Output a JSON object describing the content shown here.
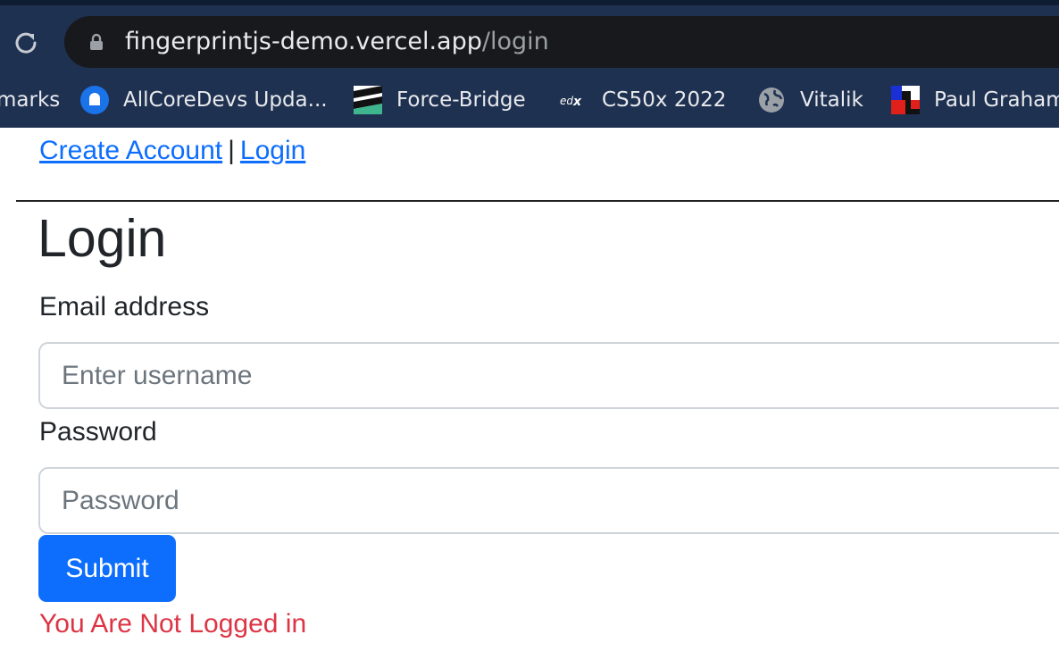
{
  "browser": {
    "url_host": "fingerprintjs-demo.vercel.app",
    "url_path": "/login",
    "bookmarks": [
      {
        "label": "marks",
        "icon": "none"
      },
      {
        "label": "AllCoreDevs Upda...",
        "icon": "blue-circle-icon"
      },
      {
        "label": "Force-Bridge",
        "icon": "stripes-icon"
      },
      {
        "label": "CS50x 2022",
        "icon": "edx-icon"
      },
      {
        "label": "Vitalik",
        "icon": "globe-icon"
      },
      {
        "label": "Paul Graham",
        "icon": "pg-icon"
      }
    ]
  },
  "nav": {
    "create_account": "Create Account",
    "separator": "|",
    "login": "Login"
  },
  "form": {
    "title": "Login",
    "email_label": "Email address",
    "email_placeholder": "Enter username",
    "email_value": "",
    "password_label": "Password",
    "password_placeholder": "Password",
    "password_value": "",
    "submit_label": "Submit"
  },
  "status": {
    "message": "You Are Not Logged in"
  },
  "colors": {
    "link": "#0d6efd",
    "button": "#0d6efd",
    "error": "#dc3545",
    "chrome_bg": "#1f3151"
  }
}
